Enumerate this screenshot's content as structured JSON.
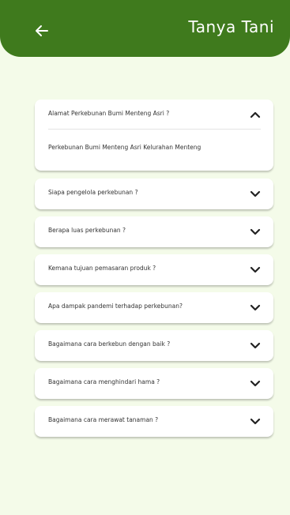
{
  "header": {
    "title": "Tanya Tani",
    "back_icon": "arrow-left-icon"
  },
  "colors": {
    "appbar": "#3f7a1d",
    "background": "#f4fbe9",
    "card": "#ffffff",
    "text": "#333333"
  },
  "faq": [
    {
      "question": "Alamat Perkebunan Bumi Menteng Asri ?",
      "answer": "Perkebunan Bumi Menteng Asri Kelurahan Menteng",
      "expanded": true
    },
    {
      "question": "Siapa pengelola perkebunan ?",
      "expanded": false
    },
    {
      "question": "Berapa luas perkebunan ?",
      "expanded": false
    },
    {
      "question": "Kemana tujuan pemasaran produk ?",
      "expanded": false
    },
    {
      "question": "Apa dampak pandemi terhadap perkebunan?",
      "expanded": false
    },
    {
      "question": "Bagaimana cara berkebun dengan baik ?",
      "expanded": false
    },
    {
      "question": "Bagaimana cara menghindari hama ?",
      "expanded": false
    },
    {
      "question": "Bagaimana cara merawat tanaman ?",
      "expanded": false
    }
  ]
}
